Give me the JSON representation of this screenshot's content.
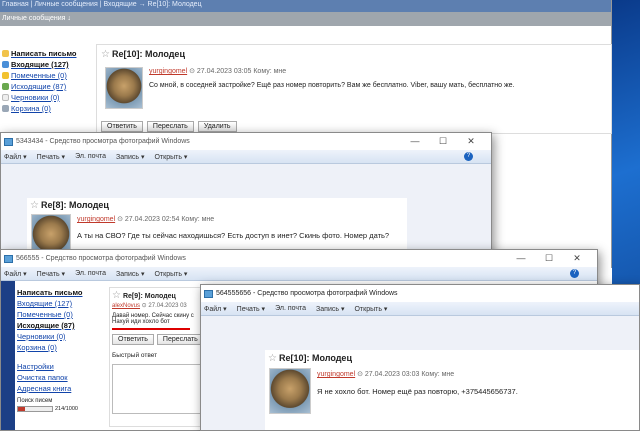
{
  "bg_window": {
    "breadcrumb": "Главная | Личные сообщения | Входящие → Re[10]: Молодец",
    "tab": "Личные сообщения ↓",
    "sidebar": [
      {
        "label": "Написать письмо",
        "icon": "compose-icon"
      },
      {
        "label": "Входящие (127)",
        "icon": "inbox-icon"
      },
      {
        "label": "Помеченные (0)",
        "icon": "star-icon"
      },
      {
        "label": "Исходящие (87)",
        "icon": "outbox-icon"
      },
      {
        "label": "Черновики (0)",
        "icon": "drafts-icon"
      },
      {
        "label": "Корзина (0)",
        "icon": "trash-icon"
      }
    ],
    "message": {
      "subject": "Re[10]: Молодец",
      "author": "yurgingomel",
      "date": "27.04.2023 03:05",
      "to": "Кому: мне",
      "body": "Со мной, в соседней застройке? Ещё раз номер повторить? Вам же бесплатно. Viber, вашу мать, бесплатно же."
    },
    "buttons": [
      "Ответить",
      "Переслать",
      "Удалить"
    ]
  },
  "viewer1": {
    "title": "5343434 - Средство просмотра фотографий Windows",
    "menu": [
      "Файл ▾",
      "Печать ▾",
      "Эл. почта",
      "Запись ▾",
      "Открыть ▾"
    ],
    "message": {
      "subject": "Re[8]: Молодец",
      "author": "yurgingomel",
      "date": "27.04.2023 02:54",
      "to": "Кому: мне",
      "body": "А ты на СВО? Где ты сейчас находишься? Есть доступ в инет? Скинь фото. Номер дать?"
    }
  },
  "viewer2": {
    "title": "566555 - Средство просмотра фотографий Windows",
    "menu": [
      "Файл ▾",
      "Печать ▾",
      "Эл. почта",
      "Запись ▾",
      "Открыть ▾"
    ],
    "sidebar": [
      {
        "label": "Написать письмо"
      },
      {
        "label": "Входящие (127)"
      },
      {
        "label": "Помеченные (0)"
      },
      {
        "label": "Исходящие (87)"
      },
      {
        "label": "Черновики (0)"
      },
      {
        "label": "Корзина (0)"
      },
      {
        "label": "Настройки"
      },
      {
        "label": "Очистка папок"
      },
      {
        "label": "Адресная книга"
      }
    ],
    "storage_label": "Поиск писем",
    "storage_value": "214/1000",
    "storage_fraction": 0.214,
    "message": {
      "subject": "Re[9]: Молодец",
      "author": "alexNovus",
      "date": "27.04.2023 03",
      "line1": "Давай номер. Сейчас скину с",
      "line2": "Нахуй иди хохло бот"
    },
    "buttons": [
      "Ответить",
      "Переслать"
    ],
    "quick_reply": "Быстрый ответ"
  },
  "viewer3": {
    "title": "564555656 - Средство просмотра фотографий Windows",
    "menu": [
      "Файл ▾",
      "Печать ▾",
      "Эл. почта",
      "Запись ▾",
      "Открыть ▾"
    ],
    "message": {
      "subject": "Re[10]: Молодец",
      "author": "yurgingomel",
      "date": "27.04.2023 03:03",
      "to": "Кому: мне",
      "body": "Я не хохло бот. Номер ещё раз повторю, +375445656737."
    }
  }
}
